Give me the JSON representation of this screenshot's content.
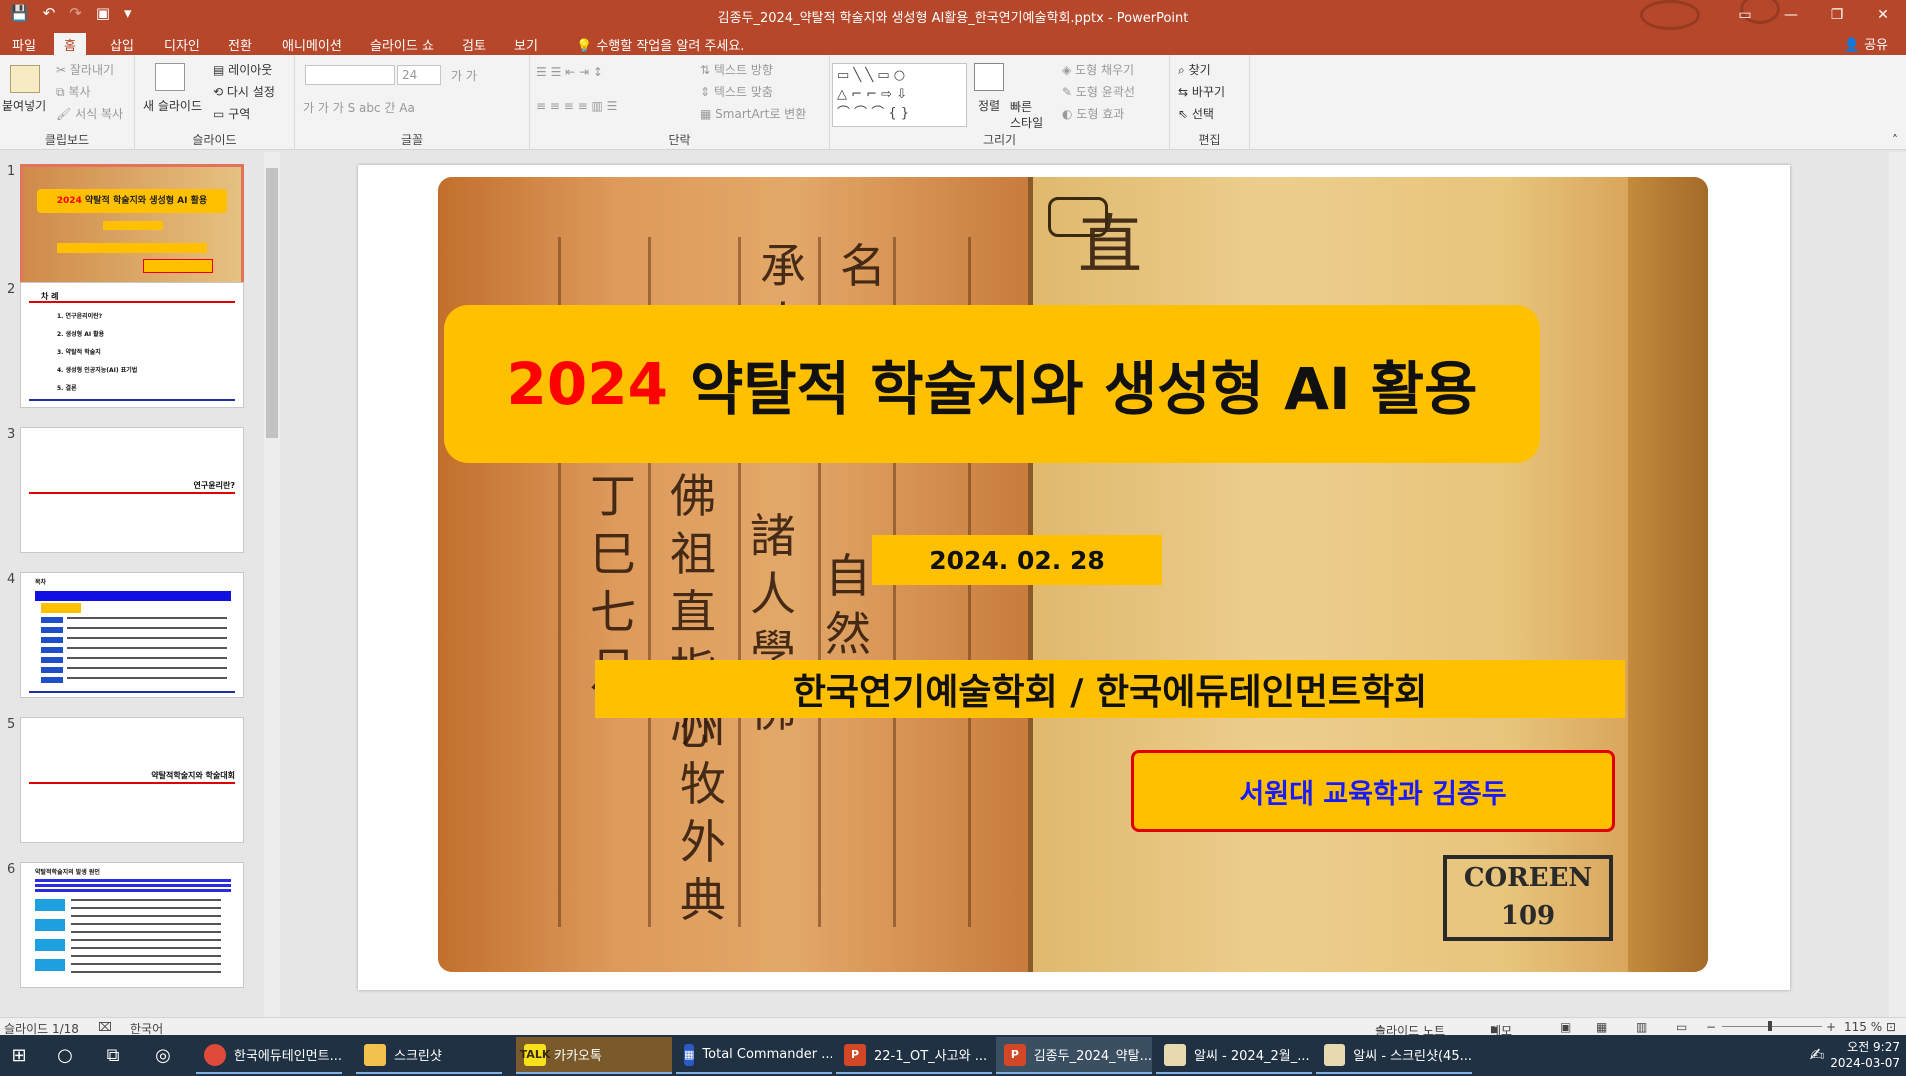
{
  "window": {
    "title": "김종두_2024_약탈적 학술지와 생성형 AI활용_한국연기예술학회.pptx  -  PowerPoint",
    "qat_icons": [
      "save-icon",
      "undo-icon",
      "redo-icon",
      "present-icon",
      "customize-icon"
    ]
  },
  "ribbon": {
    "tabs": [
      "파일",
      "홈",
      "삽입",
      "디자인",
      "전환",
      "애니메이션",
      "슬라이드 쇼",
      "검토",
      "보기"
    ],
    "active_tab": "홈",
    "tell_me": "수행할 작업을 알려 주세요.",
    "share": "공유",
    "clipboard": {
      "paste": "붙여넣기",
      "cut": "잘라내기",
      "copy": "복사",
      "format_painter": "서식 복사",
      "label": "클립보드"
    },
    "slides": {
      "new_slide": "새 슬라이드",
      "layout": "레이아웃",
      "reset": "다시 설정",
      "section": "구역",
      "label": "슬라이드"
    },
    "font": {
      "font_size": "24",
      "label": "글꼴"
    },
    "paragraph": {
      "text_direction": "텍스트 방향",
      "align_text": "텍스트 맞춤",
      "smartart": "SmartArt로 변환",
      "label": "단락"
    },
    "drawing": {
      "arrange": "정렬",
      "quick_styles": "빠른\n스타일",
      "fill": "도형 채우기",
      "outline": "도형 윤곽선",
      "effects": "도형 효과",
      "label": "그리기"
    },
    "editing": {
      "find": "찾기",
      "replace": "바꾸기",
      "select": "선택",
      "label": "편집"
    }
  },
  "thumbnails": [
    {
      "num": "1",
      "selected": true
    },
    {
      "num": "2",
      "title": "차 례",
      "items": [
        "1. 연구윤리이란?",
        "2. 생성형 AI 활용",
        "3. 약탈적 학술지",
        "4. 생성형 인공지능(AI) 표기법",
        "5. 결론"
      ]
    },
    {
      "num": "3",
      "text": "연구윤리란?"
    },
    {
      "num": "4",
      "text": "목차"
    },
    {
      "num": "5",
      "text": "약탈적학술지와 학술대회"
    },
    {
      "num": "6",
      "text": "약탈적학술지의 발생 원인"
    }
  ],
  "slide": {
    "title_year": "2024",
    "title_rest": "약탈적 학술지와 생성형 AI 활용",
    "date": "2024. 02. 28",
    "org": "한국연기예술학회 / 한국에듀테인먼트학회",
    "author": "서원대 교육학과 김종두",
    "stamp_line1": "COREEN",
    "stamp_line2": "109"
  },
  "status": {
    "slide_counter": "슬라이드 1/18",
    "language": "한국어",
    "notes": "슬라이드 노트",
    "comments": "메모",
    "zoom": "115 %"
  },
  "taskbar": {
    "items": [
      {
        "label": "한국에듀테인먼트...",
        "icon": "chrome-icon"
      },
      {
        "label": "스크린샷",
        "icon": "folder-icon"
      },
      {
        "label": "카카오톡",
        "icon": "kakaotalk-icon"
      },
      {
        "label": "Total Commander ...",
        "icon": "total-commander-icon"
      },
      {
        "label": "22-1_OT_사고와 ...",
        "icon": "powerpoint-icon"
      },
      {
        "label": "김종두_2024_약탈...",
        "icon": "powerpoint-icon"
      },
      {
        "label": "알씨 - 2024_2월_...",
        "icon": "alsee-icon"
      },
      {
        "label": "알씨 - 스크린샷(45...",
        "icon": "alsee-icon"
      }
    ],
    "time": "오전 9:27",
    "date": "2024-03-07"
  }
}
